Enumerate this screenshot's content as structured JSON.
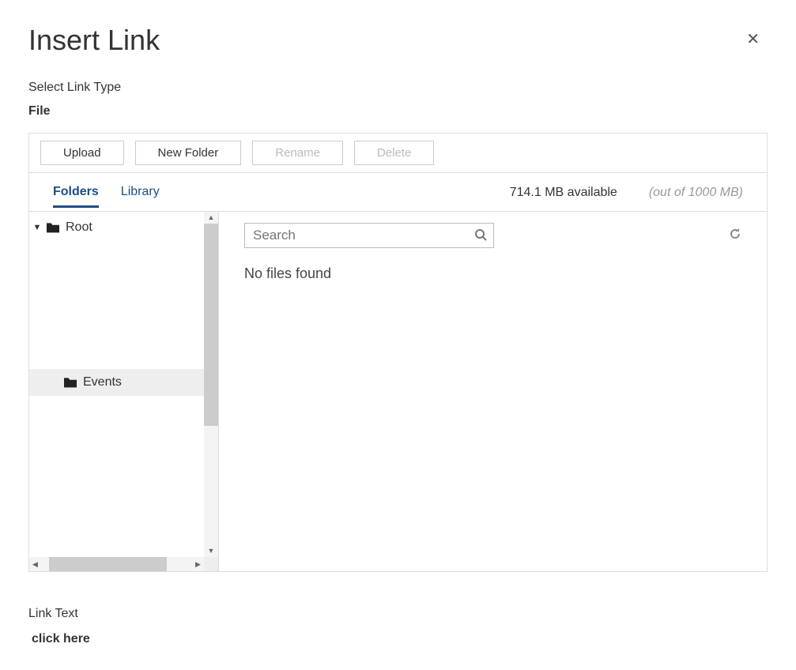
{
  "dialog": {
    "title": "Insert Link",
    "select_label": "Select Link Type",
    "link_type": "File"
  },
  "toolbar": {
    "upload": "Upload",
    "new_folder": "New Folder",
    "rename": "Rename",
    "delete": "Delete"
  },
  "tabs": {
    "folders": "Folders",
    "library": "Library"
  },
  "storage": {
    "available": "714.1 MB available",
    "total": "(out of 1000 MB)"
  },
  "tree": {
    "root": "Root",
    "child": "Events"
  },
  "search": {
    "placeholder": "Search"
  },
  "content": {
    "no_files": "No files found"
  },
  "link_text": {
    "label": "Link Text",
    "value": "click here"
  }
}
